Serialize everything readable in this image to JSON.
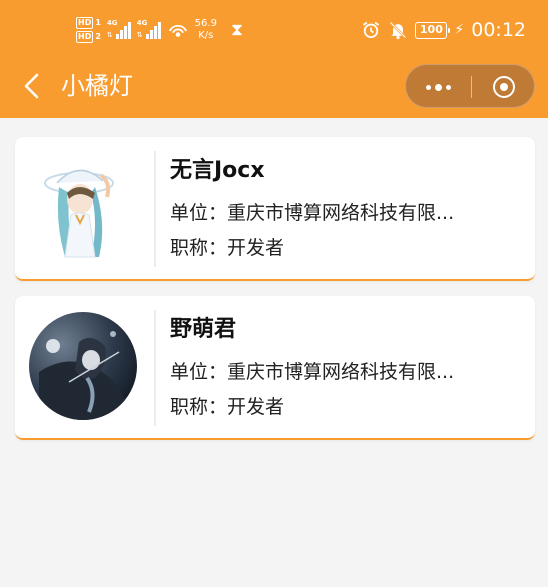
{
  "status_bar": {
    "hd1": "HD",
    "sim1": "1",
    "hd2": "HD",
    "sim2": "2",
    "net1": "4G",
    "net2": "4G",
    "speed_value": "56.9",
    "speed_unit": "K/s",
    "battery": "100",
    "time": "00:12",
    "icons": [
      "wifi-hotspot-icon",
      "hourglass-icon",
      "alarm-icon",
      "bell-off-icon",
      "battery-icon",
      "charging-bolt-icon"
    ]
  },
  "nav": {
    "title": "小橘灯",
    "back_icon": "chevron-left-icon",
    "more_icon": "more-dots-icon",
    "close_icon": "target-circle-icon"
  },
  "cards": [
    {
      "name": "无言Jocx",
      "unit_label": "单位：",
      "unit": "重庆市博算网络科技有限...",
      "title_label": "职称：",
      "title": "开发者"
    },
    {
      "name": "野萌君",
      "unit_label": "单位：",
      "unit": "重庆市博算网络科技有限...",
      "title_label": "职称：",
      "title": "开发者"
    }
  ],
  "colors": {
    "header": "#f99c30",
    "capsule": "#bf7a36",
    "background": "#f4f4f4",
    "card_accent": "#f99c30"
  }
}
